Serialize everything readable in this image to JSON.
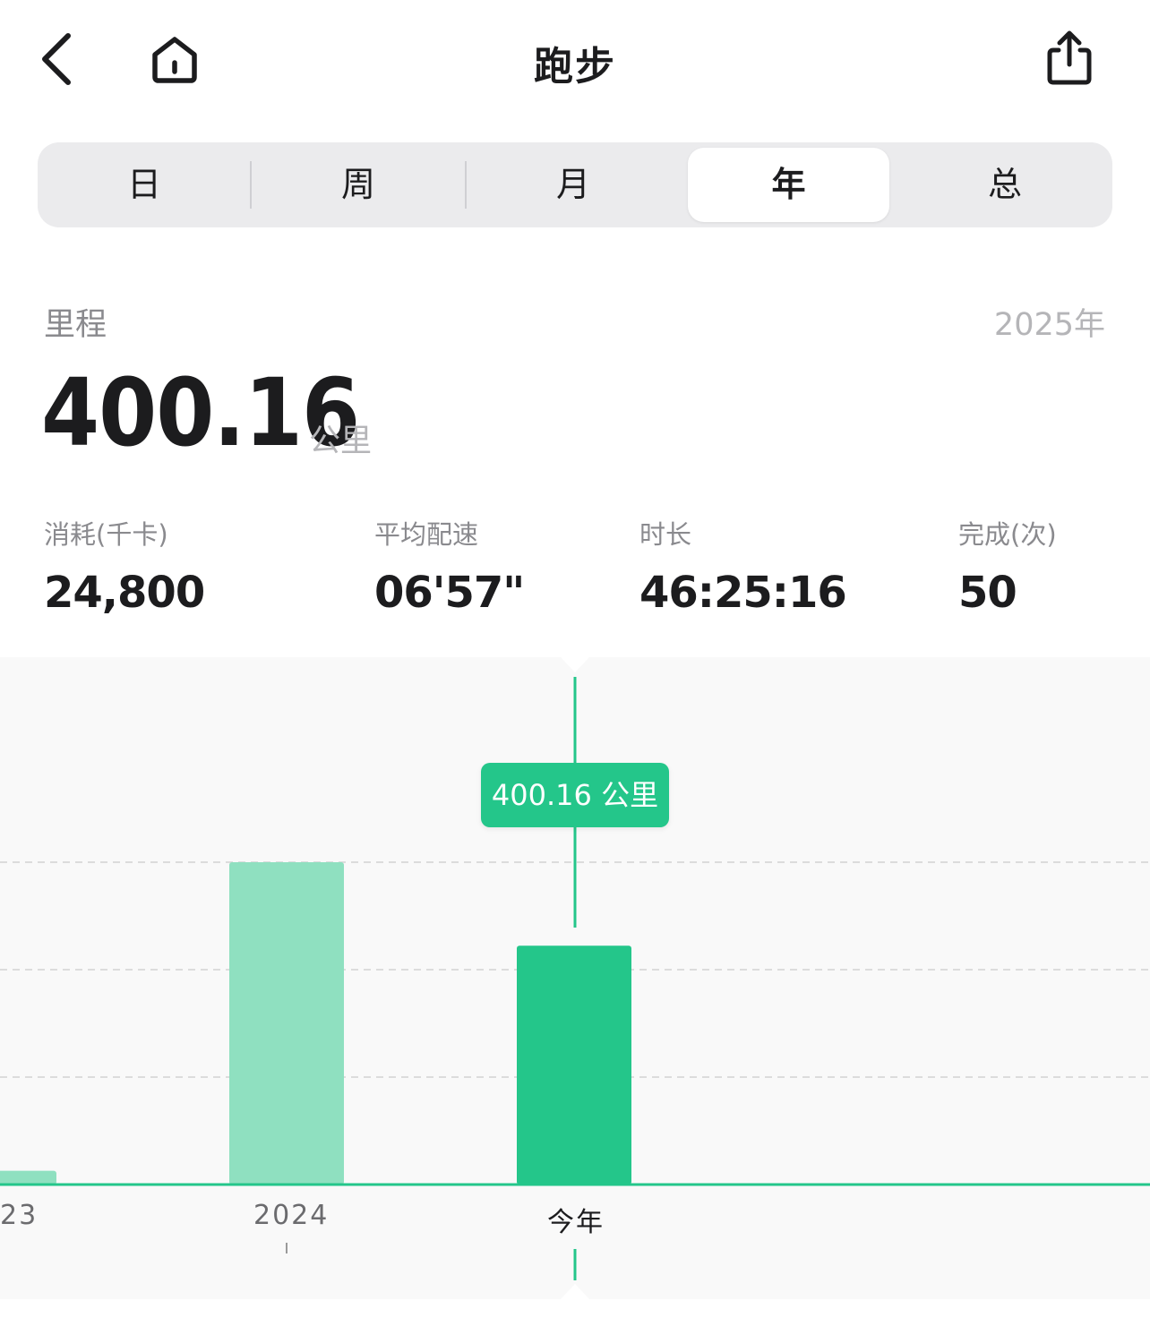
{
  "nav": {
    "title": "跑步",
    "back_icon": "chevron-left-icon",
    "home_icon": "home-icon",
    "share_icon": "share-icon"
  },
  "segments": {
    "items": [
      "日",
      "周",
      "月",
      "年",
      "总"
    ],
    "selected": "年"
  },
  "summary": {
    "label": "里程",
    "period": "2025年",
    "value": "400.16",
    "unit": "公里"
  },
  "stats": [
    {
      "label": "消耗(千卡)",
      "value": "24,800"
    },
    {
      "label": "平均配速",
      "value": "06'57\""
    },
    {
      "label": "时长",
      "value": "46:25:16"
    },
    {
      "label": "完成(次)",
      "value": "50"
    }
  ],
  "tooltip": {
    "text": "400.16 公里"
  },
  "colors": {
    "accent": "#24c68a",
    "bar_inactive": "#8fe0c0",
    "chart_bg": "#f9f9f9"
  },
  "chart_data": {
    "type": "bar",
    "categories": [
      "23",
      "2024",
      "今年"
    ],
    "values": [
      23,
      540,
      400.16
    ],
    "selected_index": 2,
    "unit": "公里",
    "grid": true
  }
}
